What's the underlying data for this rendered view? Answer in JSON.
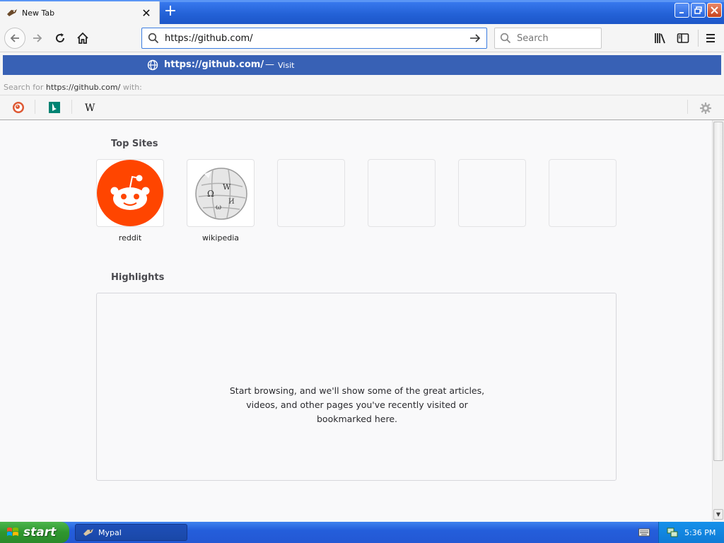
{
  "browser": {
    "tab": {
      "title": "New Tab"
    },
    "newtab_symbol": "+",
    "url": "https://github.com/",
    "search_placeholder": "Search",
    "suggestion": {
      "url": "https://github.com/",
      "dash": "—",
      "action": "Visit"
    },
    "search_for": {
      "prefix": "Search for",
      "query": "https://github.com/",
      "suffix": "with:"
    },
    "search_engines": [
      "duckduckgo-icon",
      "bing-icon",
      "wikipedia-icon"
    ]
  },
  "content": {
    "top_sites_title": "Top Sites",
    "top_sites": [
      {
        "label": "reddit",
        "icon": "reddit-icon"
      },
      {
        "label": "wikipedia",
        "icon": "wikipedia-globe-icon"
      }
    ],
    "highlights_title": "Highlights",
    "highlights_message": [
      "Start browsing, and we'll show some of the great articles,",
      "videos, and other pages you've recently visited or",
      "bookmarked here."
    ]
  },
  "taskbar": {
    "start_label": "start",
    "task_label": "Mypal",
    "clock": "5:36 PM"
  },
  "colors": {
    "suggestion_bg": "#3861b5",
    "reddit_orange": "#ff4500",
    "taskbar_blue": "#245edb",
    "start_green": "#2f962f"
  }
}
